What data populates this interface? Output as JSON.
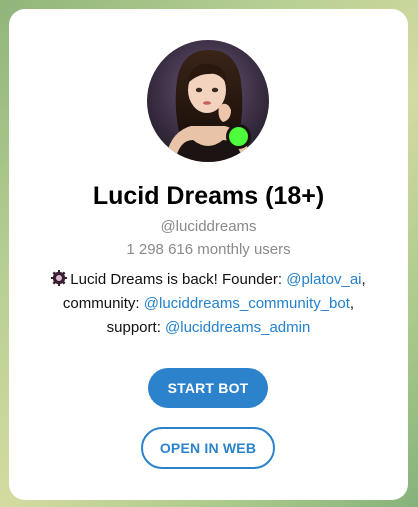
{
  "profile": {
    "name": "Lucid Dreams (18+)",
    "username": "@luciddreams",
    "monthly_users": "1 298 616 monthly users",
    "online_status_color": "#4cff3a",
    "avatar_icon": "profile-photo"
  },
  "description": {
    "icon": "gear-icon",
    "text_1": "Lucid Dreams is back! Founder: ",
    "link_founder": "@platov_ai",
    "text_2": ",",
    "text_3": "community: ",
    "link_community": "@luciddreams_community_bot",
    "text_4": ",",
    "text_5": "support: ",
    "link_support": "@luciddreams_admin"
  },
  "actions": {
    "start_label": "START BOT",
    "web_label": "OPEN IN WEB"
  },
  "colors": {
    "accent": "#2d82cc",
    "link": "#2481cc",
    "muted": "#8a8a8a"
  }
}
